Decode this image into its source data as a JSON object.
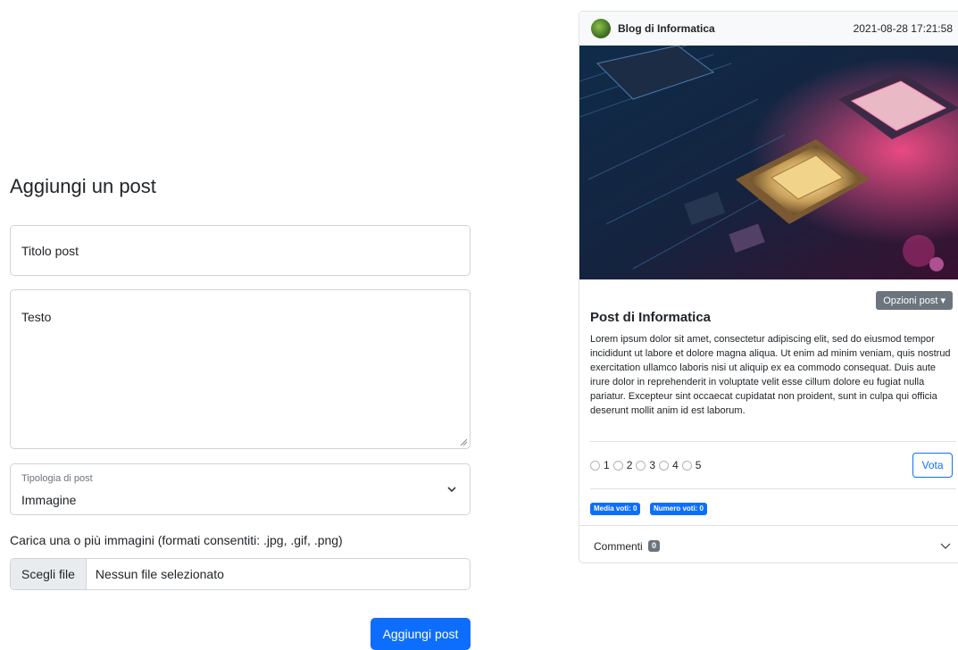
{
  "form": {
    "heading": "Aggiungi un post",
    "title_placeholder": "Titolo post",
    "text_placeholder": "Testo",
    "type_label": "Tipologia di post",
    "type_value": "Immagine",
    "upload_label": "Carica una o più immagini (formati consentiti: .jpg, .gif, .png)",
    "file_button": "Scegli file",
    "file_status": "Nessun file selezionato",
    "submit_label": "Aggiungi post"
  },
  "card": {
    "blog_name": "Blog di Informatica",
    "date": "2021-08-28 17:21:58",
    "options_label": "Opzioni post",
    "post_title": "Post di Informatica",
    "post_body": "Lorem ipsum dolor sit amet, consectetur adipiscing elit, sed do eiusmod tempor incididunt ut labore et dolore magna aliqua. Ut enim ad minim veniam, quis nostrud exercitation ullamco laboris nisi ut aliquip ex ea commodo consequat. Duis aute irure dolor in reprehenderit in voluptate velit esse cillum dolore eu fugiat nulla pariatur. Excepteur sint occaecat cupidatat non proident, sunt in culpa qui officia deserunt mollit anim id est laborum.",
    "rating_options": [
      "1",
      "2",
      "3",
      "4",
      "5"
    ],
    "vote_label": "Vota",
    "avg_badge": "Media voti: 0",
    "count_badge": "Numero voti: 0",
    "comments_label": "Commenti",
    "comments_count": "0"
  },
  "colors": {
    "primary": "#0d6efd",
    "secondary": "#6c757d",
    "border": "#ced4da"
  },
  "icons": {
    "select_chevron": "chevron-down-icon",
    "comments_chevron": "chevron-down-icon",
    "avatar": "avatar-image",
    "post_image": "cpu-chip-photo"
  }
}
